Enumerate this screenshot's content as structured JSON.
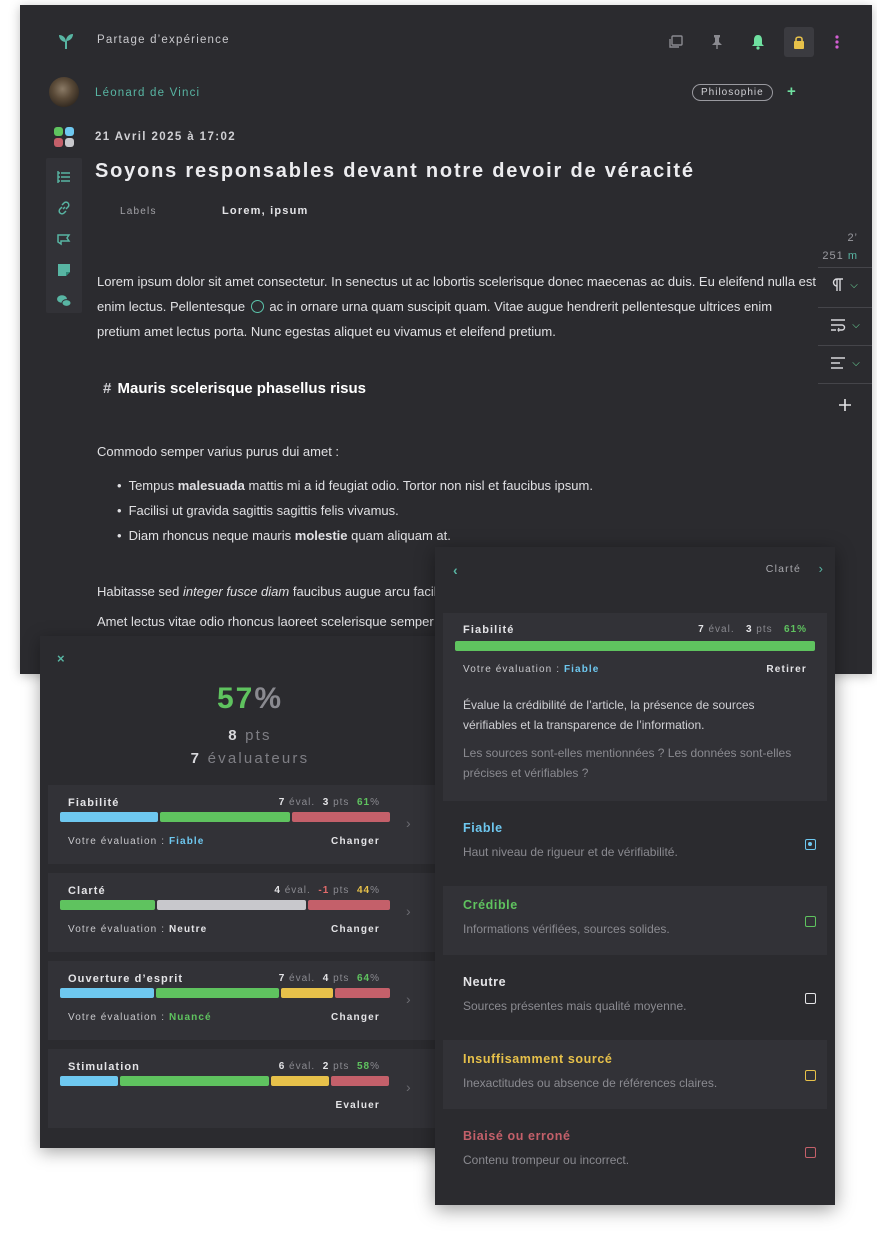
{
  "editor": {
    "app_title": "Partage d’expérience",
    "author": "Léonard de Vinci",
    "tag": "Philosophie",
    "tag_add": "+",
    "date": "21 Avril 2025 à 17:02",
    "title": "Soyons responsables devant notre devoir de véracité",
    "labels_key": "Labels",
    "labels_value": "Lorem, ipsum",
    "reading_time": "2’",
    "word_count": "251",
    "word_unit": "m",
    "para1_a": "Lorem ipsum dolor sit amet consectetur. In senectus ut ac lobortis scelerisque donec maecenas ac duis. Eu eleifend nulla est enim lectus. Pellentesque",
    "para1_b": "ac in ornare urna quam suscipit quam. Vitae augue hendrerit pellentesque ultrices enim pretium amet lectus porta. Nunc egestas aliquet eu vivamus et eleifend pretium.",
    "heading_hash": "#",
    "heading": "Mauris scelerisque phasellus risus",
    "para2": "Commodo semper varius purus dui amet :",
    "bullets": [
      {
        "pre": "Tempus ",
        "bold": "malesuada",
        "post": " mattis mi a id feugiat odio. Tortor non nisl et faucibus ipsum."
      },
      {
        "pre": "Facilisi ut gravida sagittis sagittis felis vivamus.",
        "bold": "",
        "post": ""
      },
      {
        "pre": "Diam rhoncus neque mauris ",
        "bold": "molestie",
        "post": " quam aliquam at."
      }
    ],
    "para3_pre": "Habitasse sed ",
    "para3_italic": "integer fusce diam",
    "para3_post": " faucibus augue arcu facilisis",
    "para4": "Amet lectus vitae odio rhoncus laoreet scelerisque semper"
  },
  "summary": {
    "close": "×",
    "score_value": "57",
    "score_symbol": "%",
    "points": "8",
    "points_unit": "pts",
    "evaluators": "7",
    "evaluators_unit": "évaluateurs",
    "eval_label": "éval.",
    "pts_label": "pts",
    "your_eval_label": "Votre évaluation :",
    "criteria": [
      {
        "name": "Fiabilité",
        "evals": "7",
        "pts": "3",
        "pct": "61",
        "pct_sym": "%",
        "pct_color": "#5fc35f",
        "segments": [
          {
            "share": 0.3,
            "color": "#6ec8f0"
          },
          {
            "share": 0.4,
            "color": "#5fc35f"
          },
          {
            "share": 0.3,
            "color": "#c4606a"
          }
        ],
        "your_eval": "Fiable",
        "your_eval_color": "#6ec8f0",
        "action": "Changer"
      },
      {
        "name": "Clarté",
        "evals": "4",
        "pts": "-1",
        "pct": "44",
        "pct_sym": "%",
        "pct_color": "#e7c14a",
        "pts_color": "#e26b6b",
        "segments": [
          {
            "share": 0.29,
            "color": "#5fc35f"
          },
          {
            "share": 0.46,
            "color": "#c8c8cc"
          },
          {
            "share": 0.25,
            "color": "#c4606a"
          }
        ],
        "your_eval": "Neutre",
        "your_eval_color": "#e4e4e7",
        "action": "Changer"
      },
      {
        "name": "Ouverture d’esprit",
        "evals": "7",
        "pts": "4",
        "pct": "64",
        "pct_sym": "%",
        "pct_color": "#5fc35f",
        "segments": [
          {
            "share": 0.29,
            "color": "#6ec8f0"
          },
          {
            "share": 0.38,
            "color": "#5fc35f"
          },
          {
            "share": 0.16,
            "color": "#e7c14a"
          },
          {
            "share": 0.17,
            "color": "#c4606a"
          }
        ],
        "your_eval": "Nuancé",
        "your_eval_color": "#5fc35f",
        "action": "Changer"
      },
      {
        "name": "Stimulation",
        "evals": "6",
        "pts": "2",
        "pct": "58",
        "pct_sym": "%",
        "pct_color": "#5fc35f",
        "segments": [
          {
            "share": 0.18,
            "color": "#6ec8f0"
          },
          {
            "share": 0.46,
            "color": "#5fc35f"
          },
          {
            "share": 0.18,
            "color": "#e7c14a"
          },
          {
            "share": 0.18,
            "color": "#c4606a"
          }
        ],
        "your_eval": "",
        "your_eval_color": "#e4e4e7",
        "action": "Evaluer"
      }
    ]
  },
  "detail": {
    "next_label": "Clarté",
    "name": "Fiabilité",
    "evals": "7",
    "eval_label": "éval.",
    "pts": "3",
    "pts_label": "pts",
    "pct": "61%",
    "bar_color": "#5fc35f",
    "your_eval_label": "Votre évaluation :",
    "your_eval": "Fiable",
    "remove": "Retirer",
    "description": "Évalue la crédibilité de l’article, la présence de sources vérifiables et la transparence de l’information.",
    "question": "Les sources sont-elles mentionnées ? Les données sont-elles précises et vérifiables ?",
    "options": [
      {
        "name": "Fiable",
        "desc": "Haut niveau de rigueur et de vérifiabilité.",
        "color": "#6ec8f0",
        "checked": true
      },
      {
        "name": "Crédible",
        "desc": "Informations vérifiées, sources solides.",
        "color": "#5fc35f",
        "checked": false
      },
      {
        "name": "Neutre",
        "desc": "Sources présentes mais qualité moyenne.",
        "color": "#e4e4e7",
        "checked": false
      },
      {
        "name": "Insuffisamment sourcé",
        "desc": "Inexactitudes ou absence de références claires.",
        "color": "#e7c14a",
        "checked": false
      },
      {
        "name": "Biaisé ou erroné",
        "desc": "Contenu trompeur ou incorrect.",
        "color": "#c4606a",
        "checked": false
      }
    ]
  },
  "colors": {
    "accent": "#58b5a3",
    "accent_bright": "#6fe0a0",
    "background": "#2b2b2f",
    "card": "#323237"
  },
  "icons": {
    "logo": "sprout-icon",
    "toolbar": [
      "window-icon",
      "pin-icon",
      "bell-icon",
      "lock-icon",
      "more-vertical-icon"
    ],
    "rail": [
      "outline-icon",
      "link-icon",
      "ribbon-icon",
      "note-icon",
      "chat-icon"
    ],
    "tools": [
      "pilcrow-icon",
      "wrap-icon",
      "align-left-icon",
      "plus-icon"
    ]
  }
}
